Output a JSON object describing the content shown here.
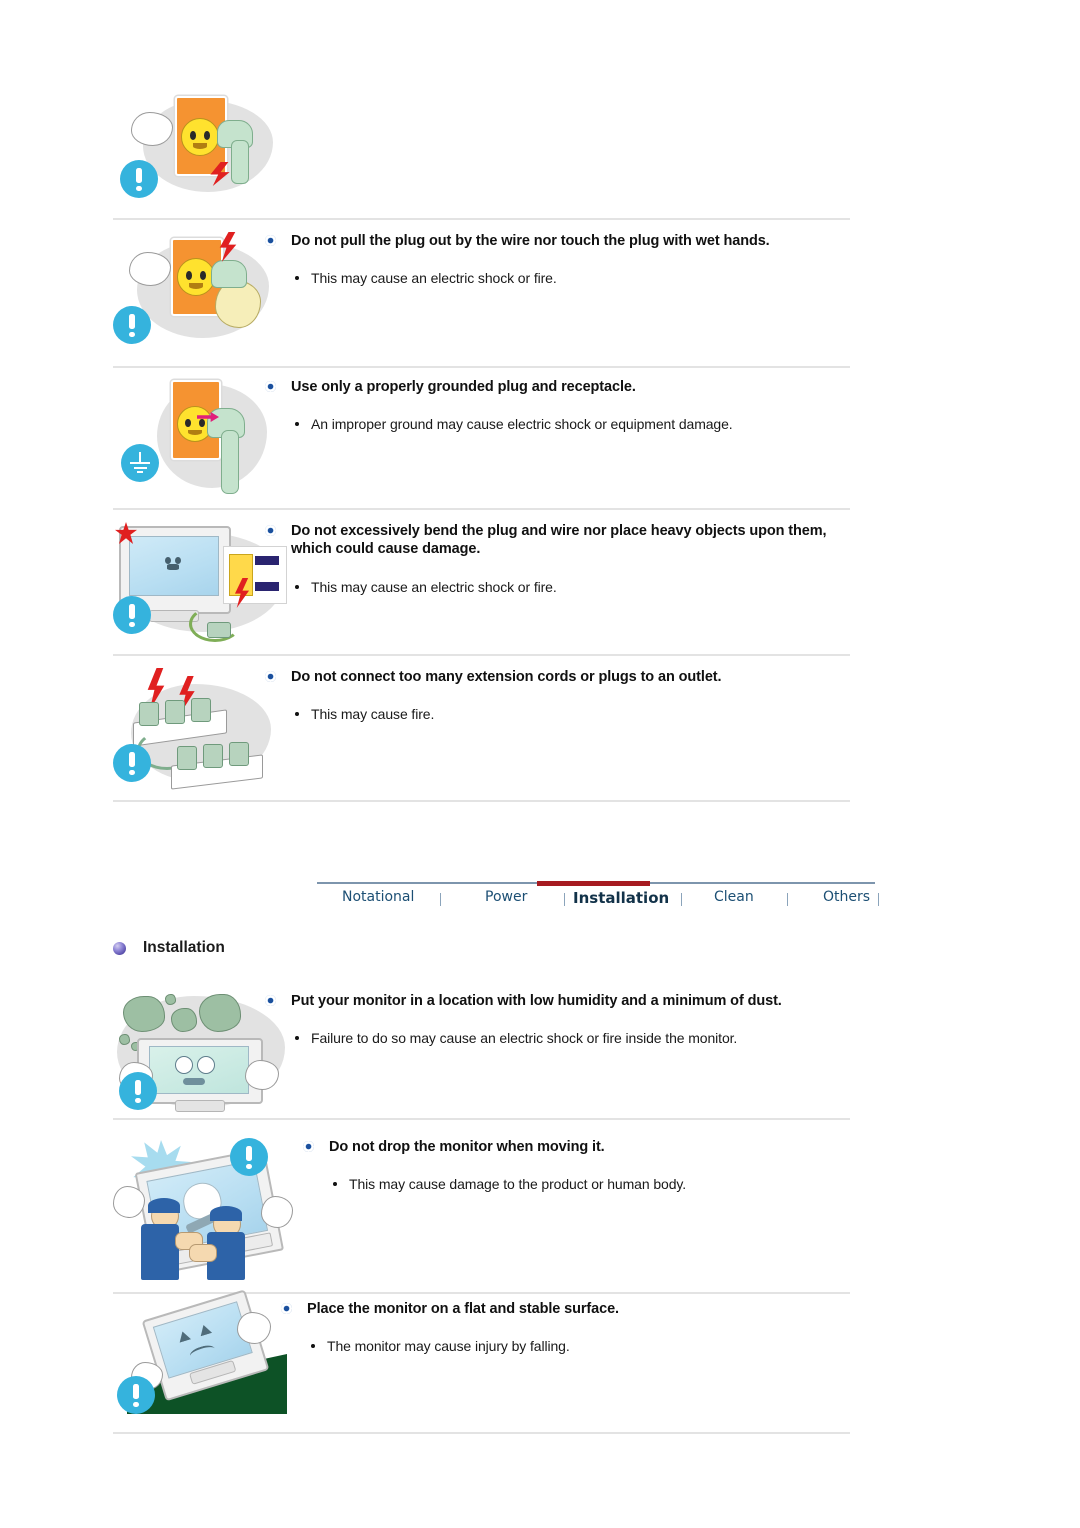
{
  "document": {
    "kind": "monitor-safety-instructions-manual-page"
  },
  "top_partial_block": {
    "illustration": "wall-outlet-plug-wet-hand-warning",
    "badge_icon": "blue-exclamation-badge"
  },
  "power_sections": [
    {
      "id": "wet-hands",
      "heading": "Do not pull the plug out by the wire nor touch the plug with wet hands.",
      "notes": [
        "This may cause an electric shock or fire."
      ],
      "illustration": "outlet-with-hand-pulling-plug",
      "badge_icon": "blue-exclamation-badge"
    },
    {
      "id": "grounded-plug",
      "heading": "Use only a properly grounded plug and receptacle.",
      "notes": [
        "An improper ground may cause electric shock or equipment damage."
      ],
      "illustration": "outlet-with-grounded-plug",
      "badge_icon": "blue-ground-symbol-badge"
    },
    {
      "id": "bend-plug",
      "heading": "Do not excessively bend the plug and wire nor place heavy objects upon them, which could cause damage.",
      "notes": [
        "This may cause an electric shock or fire."
      ],
      "illustration": "monitor-with-bent-power-cord",
      "badge_icon": "blue-exclamation-badge"
    },
    {
      "id": "extension-cords",
      "heading": "Do not connect too many extension cords or plugs to an outlet.",
      "notes": [
        "This may cause fire."
      ],
      "illustration": "overloaded-power-strips-with-sparks",
      "badge_icon": "blue-exclamation-badge"
    }
  ],
  "tabbar": {
    "tabs": [
      {
        "label": "Notational",
        "active": false
      },
      {
        "label": "Power",
        "active": false
      },
      {
        "label": "Installation",
        "active": true
      },
      {
        "label": "Clean",
        "active": false
      },
      {
        "label": "Others",
        "active": false
      }
    ],
    "active_accent_color": "#a61b21",
    "rule_color": "#7d95ad",
    "tab_color": "#1c4f74"
  },
  "section": {
    "title": "Installation",
    "orb_color": "#5b51ad"
  },
  "installation_sections": [
    {
      "id": "low-humidity-dust",
      "heading": "Put your monitor in a location with low humidity and a minimum of dust.",
      "notes": [
        "Failure to do so may cause an electric shock or fire inside the monitor."
      ],
      "illustration": "monitor-surrounded-by-dust-clouds",
      "badge_icon": "blue-exclamation-badge"
    },
    {
      "id": "do-not-drop",
      "heading": "Do not drop the monitor when moving it.",
      "notes": [
        "This may cause damage to the product or human body."
      ],
      "illustration": "two-people-dropping-monitor",
      "badge_icon": "blue-exclamation-badge"
    },
    {
      "id": "flat-stable-surface",
      "heading": "Place the monitor on a flat and stable surface.",
      "notes": [
        "The monitor may cause injury by falling."
      ],
      "illustration": "monitor-tipping-on-slope",
      "badge_icon": "blue-exclamation-badge"
    }
  ],
  "colors": {
    "badge_blue": "#35b3dd",
    "heading_bullet_blue": "#1b4f9c",
    "divider_gray": "#e3e3e3",
    "accent_red": "#a61b21",
    "tab_blue": "#1c4f74"
  }
}
